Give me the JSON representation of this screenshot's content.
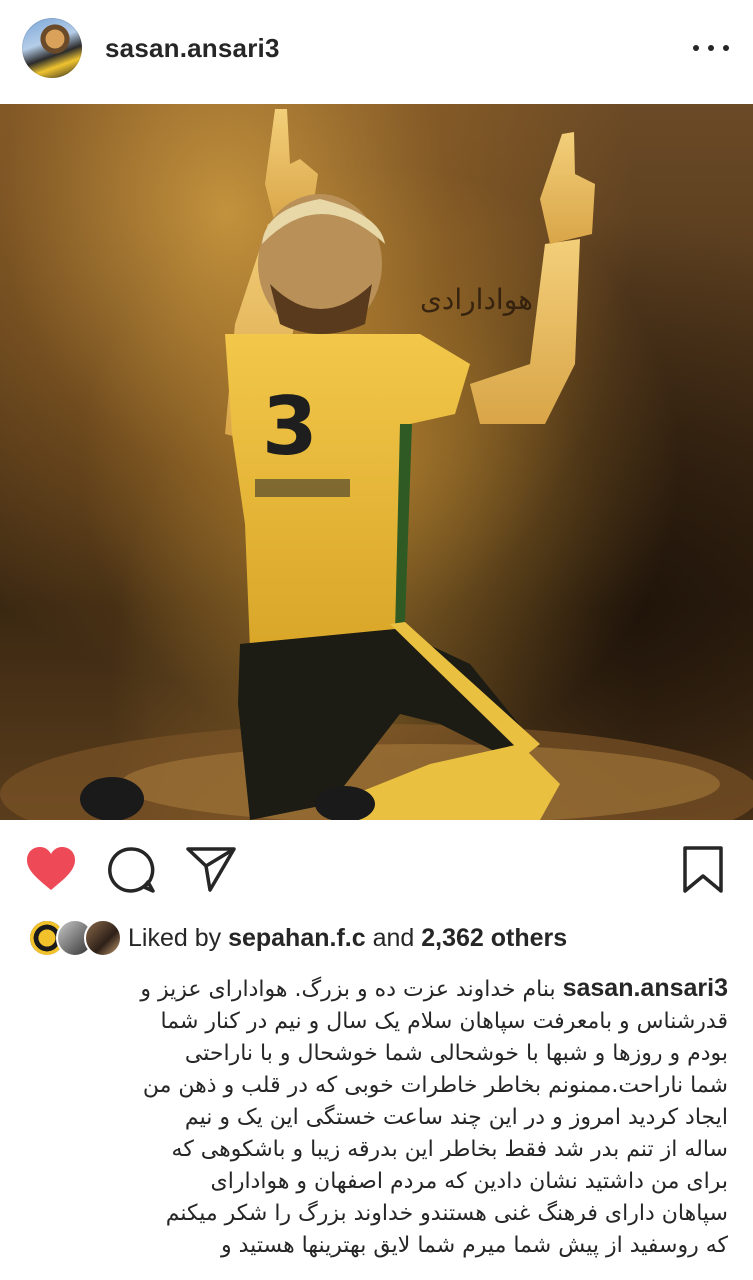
{
  "post": {
    "username": "sasan.ansari3",
    "more_icon": "more-horizontal-icon",
    "photo_signature": "هوادارادی",
    "jersey_number": "3"
  },
  "actions": {
    "like_icon": "heart-filled-icon",
    "comment_icon": "comment-bubble-icon",
    "share_icon": "paper-plane-icon",
    "save_icon": "bookmark-icon",
    "like_color": "#ed4956"
  },
  "likes": {
    "prefix": "Liked by",
    "user": "sepahan.f.c",
    "conjunction": "and",
    "count": "2,362 others"
  },
  "caption": {
    "username": "sasan.ansari3",
    "first_line_text": "بنام خداوند عزت ده و بزرگ.  هوادارای عزیز و",
    "lines": [
      "قدرشناس و بامعرفت سپاهان سلام  یک سال و نیم در کنار شما",
      "بودم و روزها و شبها با خوشحالی شما خوشحال و با ناراحتی",
      "شما ناراحت.ممنونم بخاطر خاطرات خوبی که در قلب و ذهن من",
      "ایجاد کردید امروز و در این چند ساعت خستگی این یک و نیم",
      "ساله از تنم بدر شد فقط بخاطر این بدرقه زیبا و باشکوهی که",
      "برای من داشتید  نشان دادین که مردم اصفهان و هوادارای",
      "سپاهان دارای فرهنگ غنی هستندو خداوند بزرگ را شکر میکنم",
      "که روسفید از پیش شما میرم شما لایق بهترینها هستید و"
    ]
  }
}
